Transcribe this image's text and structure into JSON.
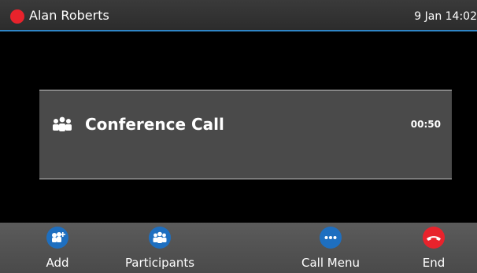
{
  "header": {
    "caller_name": "Alan Roberts",
    "datetime": "9 Jan 14:02",
    "status_color": "#e8232c",
    "accent_color": "#2f86c8"
  },
  "call": {
    "title": "Conference Call",
    "timer": "00:50",
    "icon": "conference-icon"
  },
  "softkeys": [
    {
      "label": "Add",
      "icon": "add-participant-icon",
      "color": "#1e6fc0"
    },
    {
      "label": "Participants",
      "icon": "participants-icon",
      "color": "#1e6fc0"
    },
    {
      "label": "Call Menu",
      "icon": "more-icon",
      "color": "#1e6fc0"
    },
    {
      "label": "End",
      "icon": "end-call-icon",
      "color": "#e8232c"
    }
  ]
}
